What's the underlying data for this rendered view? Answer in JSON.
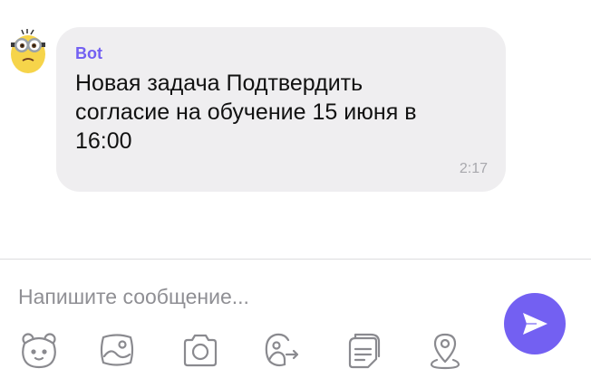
{
  "message": {
    "sender": "Bot",
    "text": "Новая задача Подтвердить согласие на обучение 15 июня в 16:00",
    "time": "2:17",
    "avatar_icon": "minion-avatar"
  },
  "composer": {
    "placeholder": "Напишите сообщение..."
  },
  "toolbar": {
    "items": [
      "sticker-icon",
      "gallery-icon",
      "camera-icon",
      "gif-doodle-icon",
      "clipboard-icon",
      "location-icon"
    ],
    "send_icon": "send-icon"
  },
  "colors": {
    "accent": "#7360f2",
    "bubble": "#efeef0",
    "icon_gray": "#8a8a8f",
    "time_gray": "#a8a8ad"
  }
}
